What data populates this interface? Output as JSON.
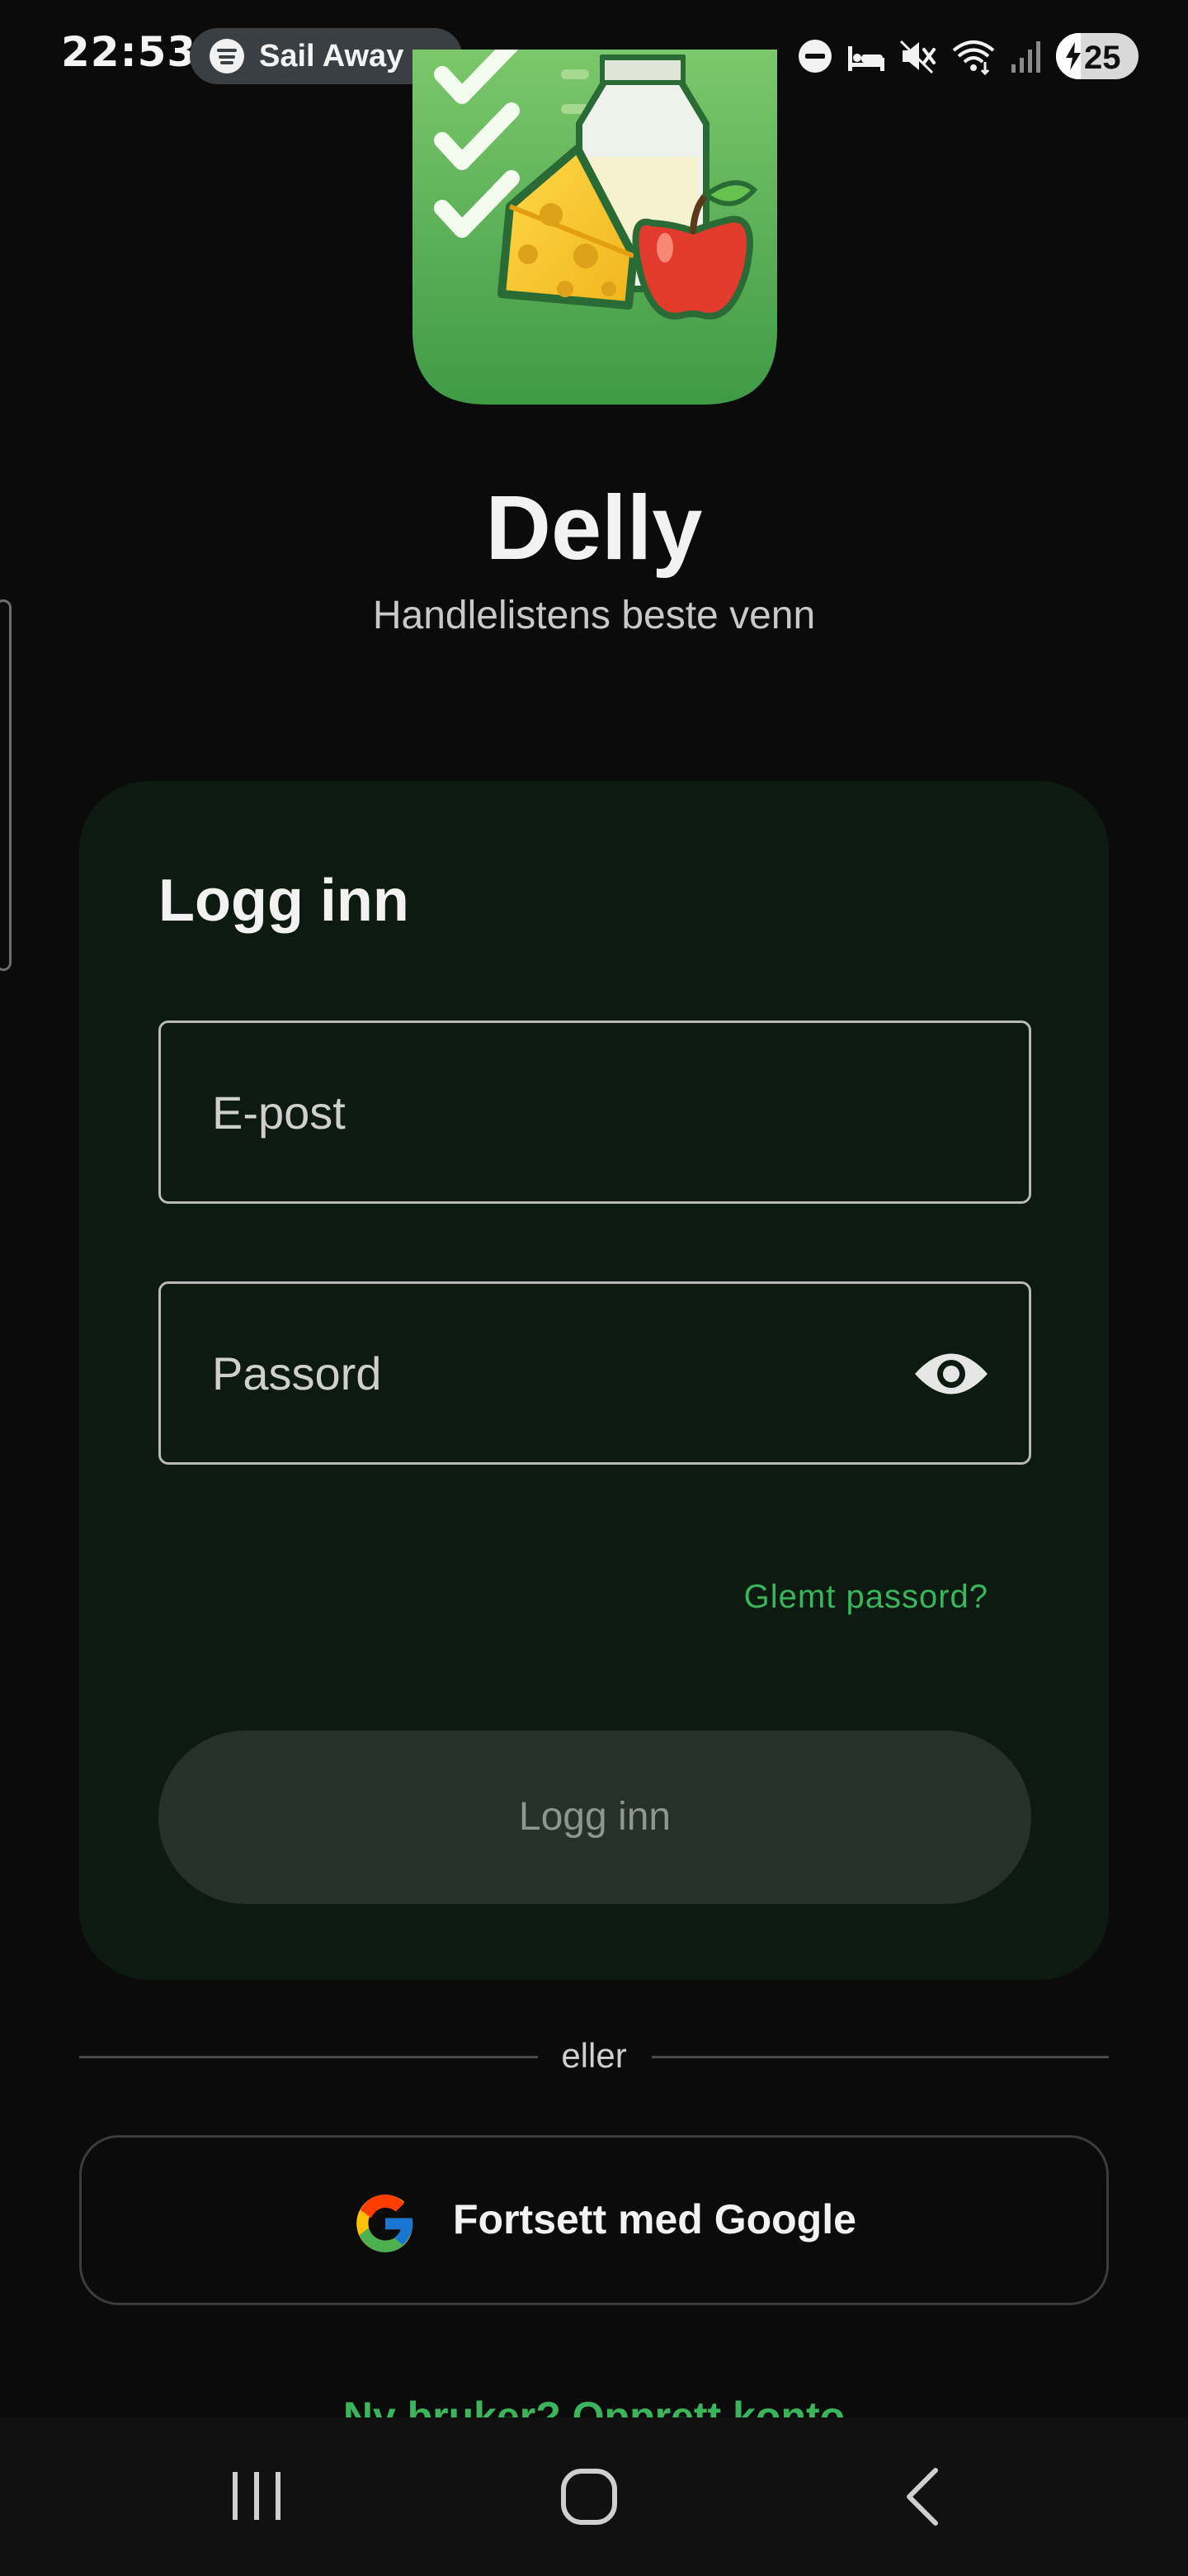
{
  "status_bar": {
    "time": "22:53",
    "media_title": "Sail Away v",
    "battery_level": "25",
    "icons": [
      "spotify-icon",
      "do-not-disturb-icon",
      "sleep-mode-icon",
      "mute-icon",
      "wifi-icon",
      "signal-icon",
      "battery-charging-icon"
    ]
  },
  "app": {
    "name": "Delly",
    "tagline": "Handlelistens beste venn"
  },
  "login_card": {
    "title": "Logg inn",
    "email_placeholder": "E-post",
    "email_value": "",
    "password_placeholder": "Passord",
    "password_value": "",
    "forgot_password": "Glemt passord?",
    "login_button": "Logg inn"
  },
  "divider_text": "eller",
  "google_button": "Fortsett med Google",
  "signup_link": "Ny bruker? Opprett konto",
  "colors": {
    "background": "#0b0b0b",
    "card": "#0d1a12",
    "accent_green": "#39b55b",
    "disabled_button": "#27312b"
  }
}
